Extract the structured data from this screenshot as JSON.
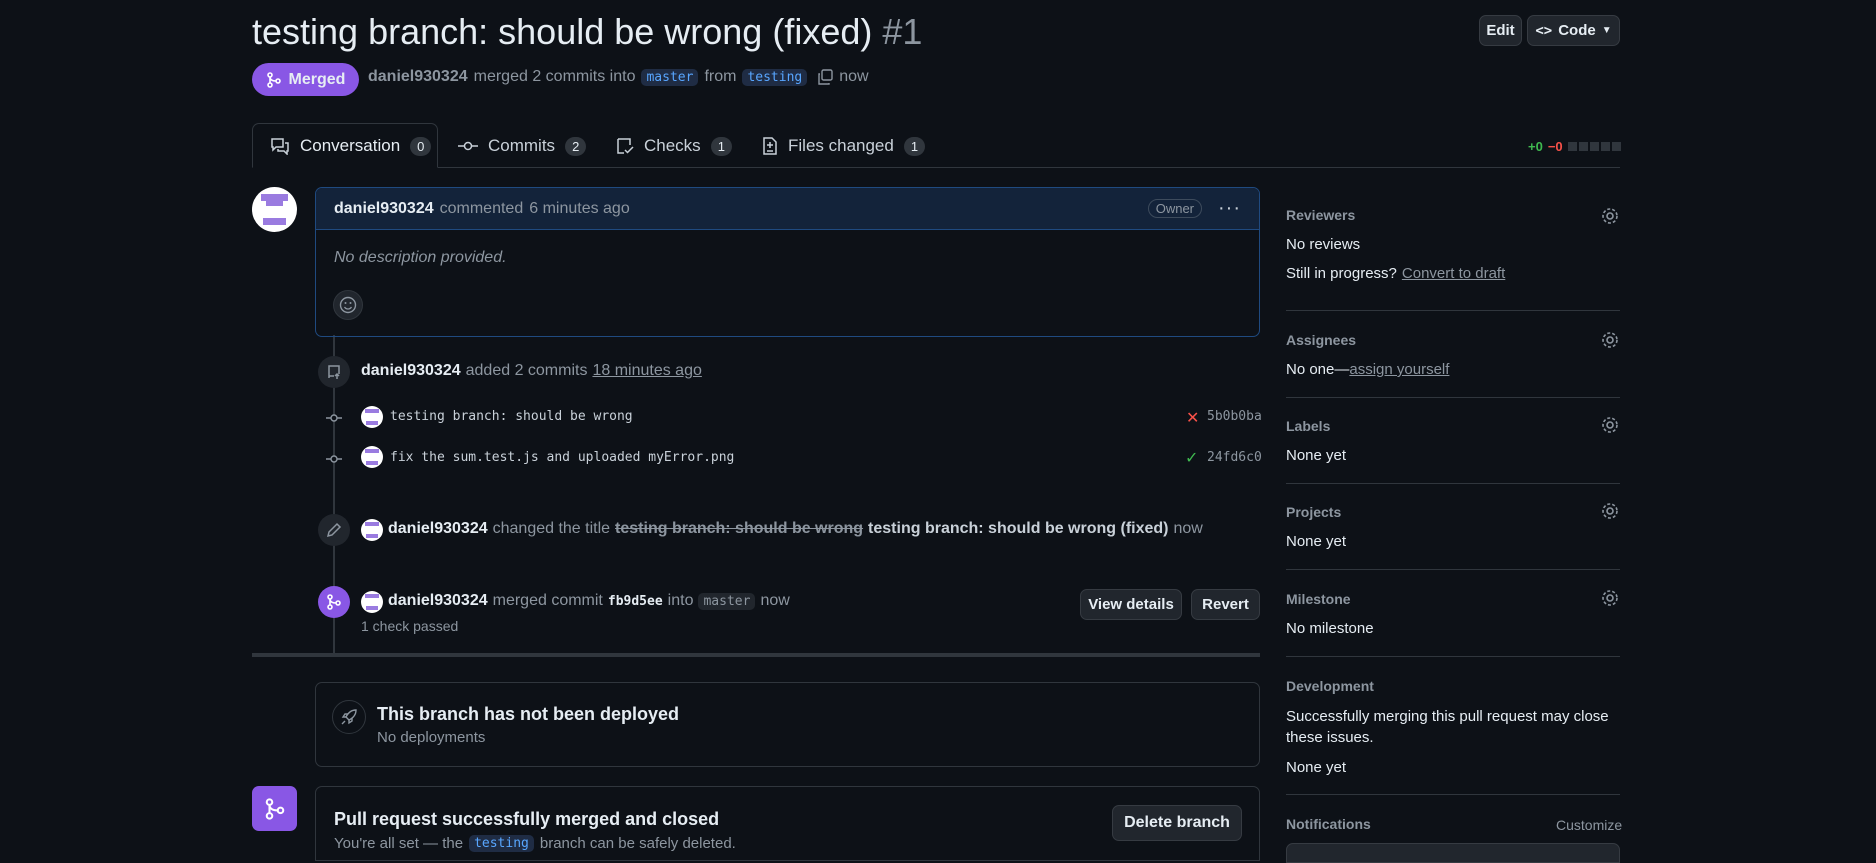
{
  "header": {
    "title": "testing branch: should be wrong (fixed)",
    "number": "#1",
    "edit_label": "Edit",
    "code_label": "Code",
    "state_label": "Merged",
    "author": "daniel930324",
    "merged_text": "merged 2 commits into",
    "base_branch": "master",
    "from_text": "from",
    "head_branch": "testing",
    "time": "now"
  },
  "tabs": [
    {
      "label": "Conversation",
      "count": "0"
    },
    {
      "label": "Commits",
      "count": "2"
    },
    {
      "label": "Checks",
      "count": "1"
    },
    {
      "label": "Files changed",
      "count": "1"
    }
  ],
  "diffstat": {
    "additions": "+0",
    "deletions": "−0"
  },
  "comment": {
    "author": "daniel930324",
    "action": "commented",
    "time": "6 minutes ago",
    "badge": "Owner",
    "body": "No description provided."
  },
  "commits_event": {
    "author": "daniel930324",
    "action": "added 2 commits",
    "time": "18 minutes ago",
    "commits": [
      {
        "message": "testing branch: should be wrong",
        "sha": "5b0b0ba",
        "status": "fail"
      },
      {
        "message": "fix the sum.test.js and uploaded myError.png",
        "sha": "24fd6c0",
        "status": "pass"
      }
    ]
  },
  "title_event": {
    "author": "daniel930324",
    "action": "changed the title",
    "old_title": "testing branch: should be wrong",
    "new_title": "testing branch: should be wrong (fixed)",
    "time": "now"
  },
  "merge_event": {
    "author": "daniel930324",
    "action": "merged commit",
    "sha": "fb9d5ee",
    "into_text": "into",
    "branch": "master",
    "time": "now",
    "checks": "1 check passed",
    "view_details_label": "View details",
    "revert_label": "Revert"
  },
  "deploy": {
    "title": "This branch has not been deployed",
    "subtitle": "No deployments"
  },
  "merged_box": {
    "title": "Pull request successfully merged and closed",
    "subtitle_pre": "You're all set — the",
    "branch": "testing",
    "subtitle_post": "branch can be safely deleted.",
    "delete_label": "Delete branch"
  },
  "sidebar": {
    "reviewers": {
      "title": "Reviewers",
      "value": "No reviews",
      "progress_text": "Still in progress?",
      "progress_link": "Convert to draft"
    },
    "assignees": {
      "title": "Assignees",
      "value": "No one—",
      "link": "assign yourself"
    },
    "labels": {
      "title": "Labels",
      "value": "None yet"
    },
    "projects": {
      "title": "Projects",
      "value": "None yet"
    },
    "milestone": {
      "title": "Milestone",
      "value": "No milestone"
    },
    "development": {
      "title": "Development",
      "text": "Successfully merging this pull request may close these issues.",
      "value": "None yet"
    },
    "notifications": {
      "title": "Notifications",
      "customize": "Customize"
    }
  },
  "colors": {
    "merged": "#8957e5",
    "accent": "#58a6ff",
    "success": "#3fb950",
    "danger": "#f85149",
    "background": "#0d1117"
  }
}
